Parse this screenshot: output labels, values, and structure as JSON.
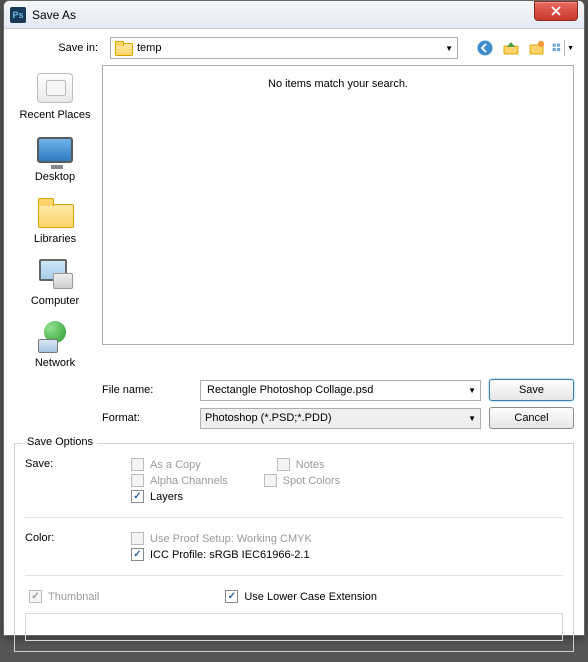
{
  "window": {
    "title": "Save As"
  },
  "topbar": {
    "savein_label": "Save in:",
    "path": "temp"
  },
  "places": [
    {
      "key": "recent",
      "label": "Recent Places"
    },
    {
      "key": "desktop",
      "label": "Desktop"
    },
    {
      "key": "libraries",
      "label": "Libraries"
    },
    {
      "key": "computer",
      "label": "Computer"
    },
    {
      "key": "network",
      "label": "Network"
    }
  ],
  "filelist": {
    "empty_text": "No items match your search."
  },
  "filename": {
    "label": "File name:",
    "value": "Rectangle Photoshop Collage.psd"
  },
  "format": {
    "label": "Format:",
    "value": "Photoshop (*.PSD;*.PDD)"
  },
  "buttons": {
    "save": "Save",
    "cancel": "Cancel"
  },
  "options": {
    "legend": "Save Options",
    "save_label": "Save:",
    "color_label": "Color:",
    "as_a_copy": "As a Copy",
    "notes": "Notes",
    "alpha": "Alpha Channels",
    "spot": "Spot Colors",
    "layers": "Layers",
    "proof": "Use Proof Setup:  Working CMYK",
    "icc": "ICC Profile:  sRGB IEC61966-2.1",
    "thumbnail": "Thumbnail",
    "lowercase": "Use Lower Case Extension"
  }
}
